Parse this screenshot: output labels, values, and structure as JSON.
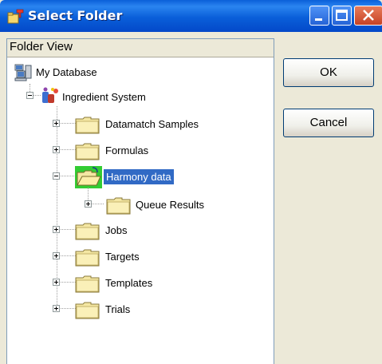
{
  "window": {
    "title": "Select Folder",
    "icon": "folder-select-icon"
  },
  "panel": {
    "header": "Folder View"
  },
  "tree": {
    "root": {
      "label": "My Database",
      "icon": "database-icon"
    },
    "system": {
      "label": "Ingredient System",
      "icon": "ingredient-system-icon",
      "expanded": true
    },
    "items": [
      {
        "label": "Datamatch Samples",
        "icon": "folder-icon",
        "expanded": false
      },
      {
        "label": "Formulas",
        "icon": "folder-icon",
        "expanded": false
      },
      {
        "label": "Harmony data",
        "icon": "folder-open-icon",
        "expanded": true,
        "selected": true,
        "children": [
          {
            "label": "Queue Results",
            "icon": "folder-icon",
            "expanded": false
          }
        ]
      },
      {
        "label": "Jobs",
        "icon": "folder-icon",
        "expanded": false
      },
      {
        "label": "Targets",
        "icon": "folder-icon",
        "expanded": false
      },
      {
        "label": "Templates",
        "icon": "folder-icon",
        "expanded": false
      },
      {
        "label": "Trials",
        "icon": "folder-icon",
        "expanded": false
      }
    ]
  },
  "buttons": {
    "ok": "OK",
    "cancel": "Cancel"
  }
}
